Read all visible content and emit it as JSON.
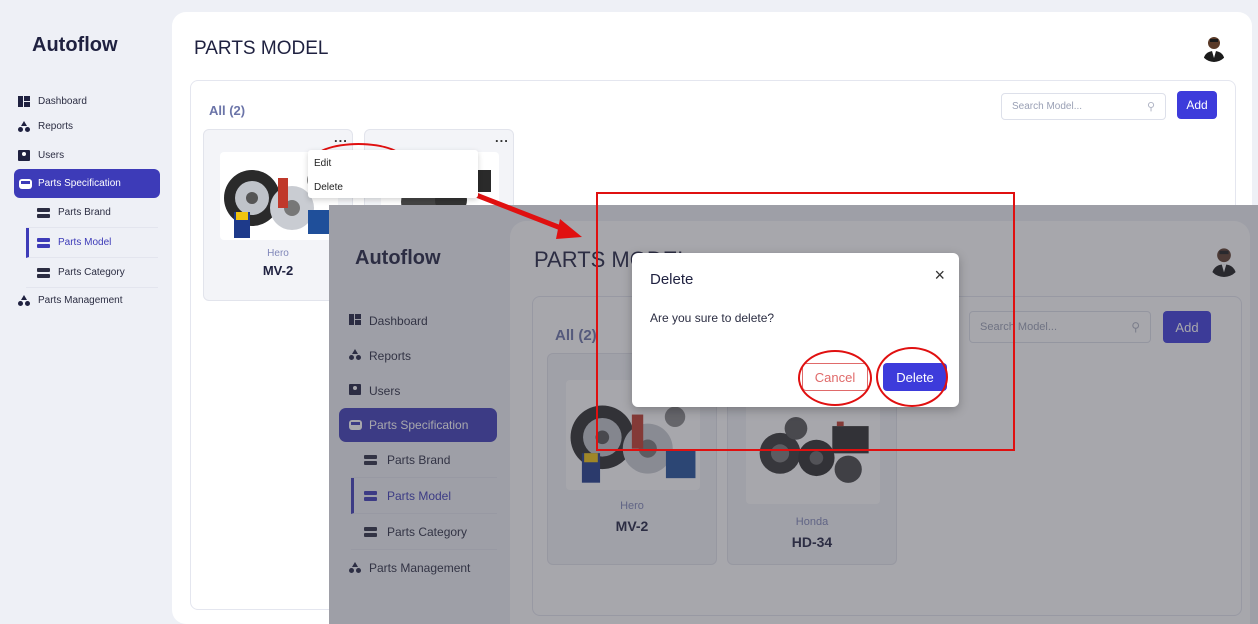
{
  "app": {
    "brand": "Autoflow",
    "page_title": "PARTS MODEL"
  },
  "sidebar": {
    "items": [
      {
        "label": "Dashboard",
        "icon": "dashboard-icon"
      },
      {
        "label": "Reports",
        "icon": "reports-icon"
      },
      {
        "label": "Users",
        "icon": "users-icon"
      },
      {
        "label": "Parts Specification",
        "icon": "bus-icon",
        "active": true
      },
      {
        "label": "Parts Brand",
        "icon": "list-icon"
      },
      {
        "label": "Parts Model",
        "icon": "list-icon",
        "active": true
      },
      {
        "label": "Parts Category",
        "icon": "list-icon"
      },
      {
        "label": "Parts Management",
        "icon": "reports-icon"
      }
    ]
  },
  "toolbar": {
    "filter_label": "All (2)",
    "search_placeholder": "Search Model...",
    "add_label": "Add"
  },
  "cards": [
    {
      "brand": "Hero",
      "model": "MV-2",
      "more": "..."
    },
    {
      "brand": "Honda",
      "model": "HD-34",
      "more": "..."
    }
  ],
  "dropdown": {
    "edit_label": "Edit",
    "delete_label": "Delete"
  },
  "modal": {
    "title": "Delete",
    "close_glyph": "×",
    "message": "Are you sure to delete?",
    "cancel_label": "Cancel",
    "delete_label": "Delete"
  },
  "search_glyph": "⚲",
  "colors": {
    "accent": "#3d3bdb",
    "sidebar_active": "#3d3bb8",
    "annotation": "#e01010",
    "cancel": "#e06a6a"
  }
}
